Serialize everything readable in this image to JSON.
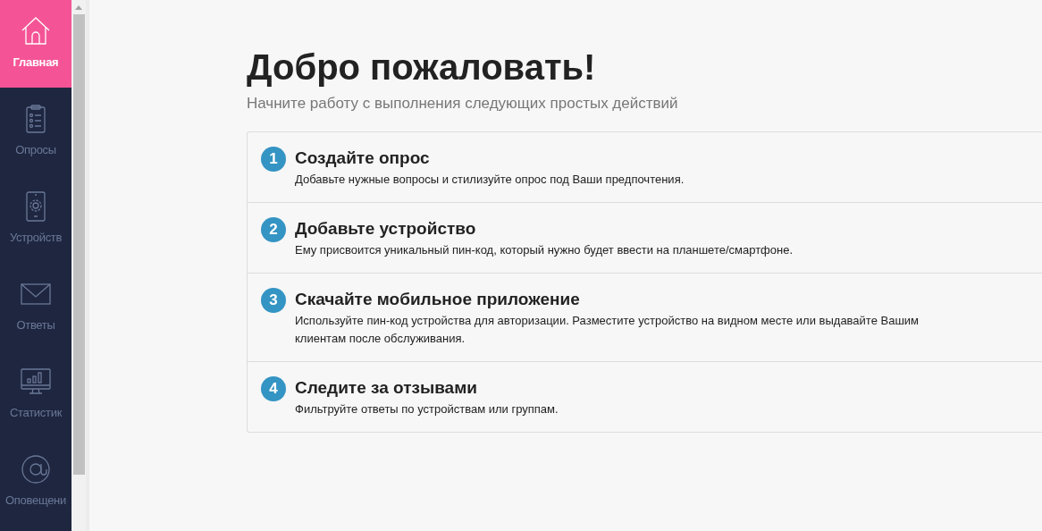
{
  "sidebar": {
    "items": [
      {
        "label": "Главная",
        "selected": true
      },
      {
        "label": "Опросы",
        "selected": false
      },
      {
        "label": "Устройств",
        "selected": false
      },
      {
        "label": "Ответы",
        "selected": false
      },
      {
        "label": "Статистик",
        "selected": false
      },
      {
        "label": "Оповещени",
        "selected": false
      }
    ]
  },
  "title": "Добро пожаловать!",
  "subtitle": "Начните работу с выполнения следующих простых действий",
  "steps": [
    {
      "number": "1",
      "title": "Создайте опрос",
      "text": "Добавьте нужные вопросы и стилизуйте опрос под Ваши предпочтения."
    },
    {
      "number": "2",
      "title": "Добавьте устройство",
      "text": "Ему присвоится уникальный пин-код, который нужно будет ввести на планшете/смартфоне."
    },
    {
      "number": "3",
      "title": "Скачайте мобильное приложение",
      "text": "Используйте пин-код устройства для авторизации. Разместите устройство на видном месте или выдавайте Вашим клиентам после обслуживания."
    },
    {
      "number": "4",
      "title": "Следите за отзывами",
      "text": "Фильтруйте ответы по устройствам или группам."
    }
  ]
}
